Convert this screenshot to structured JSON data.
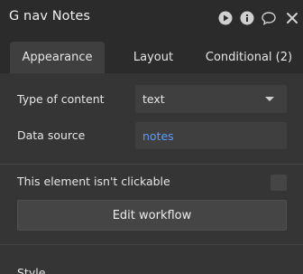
{
  "header": {
    "title": "G nav Notes"
  },
  "tabs": [
    {
      "label": "Appearance",
      "active": true
    },
    {
      "label": "Layout",
      "active": false
    },
    {
      "label": "Conditional (2)",
      "active": false
    }
  ],
  "appearance": {
    "type_of_content_label": "Type of content",
    "type_of_content_value": "text",
    "data_source_label": "Data source",
    "data_source_value": "notes",
    "not_clickable_label": "This element isn't clickable",
    "edit_workflow_label": "Edit workflow",
    "style_label": "Style"
  },
  "colors": {
    "background": "#353535",
    "header": "#2b2b2b",
    "link": "#5a9cff"
  },
  "icons": [
    "play-icon",
    "info-icon",
    "comment-icon",
    "close-icon"
  ]
}
